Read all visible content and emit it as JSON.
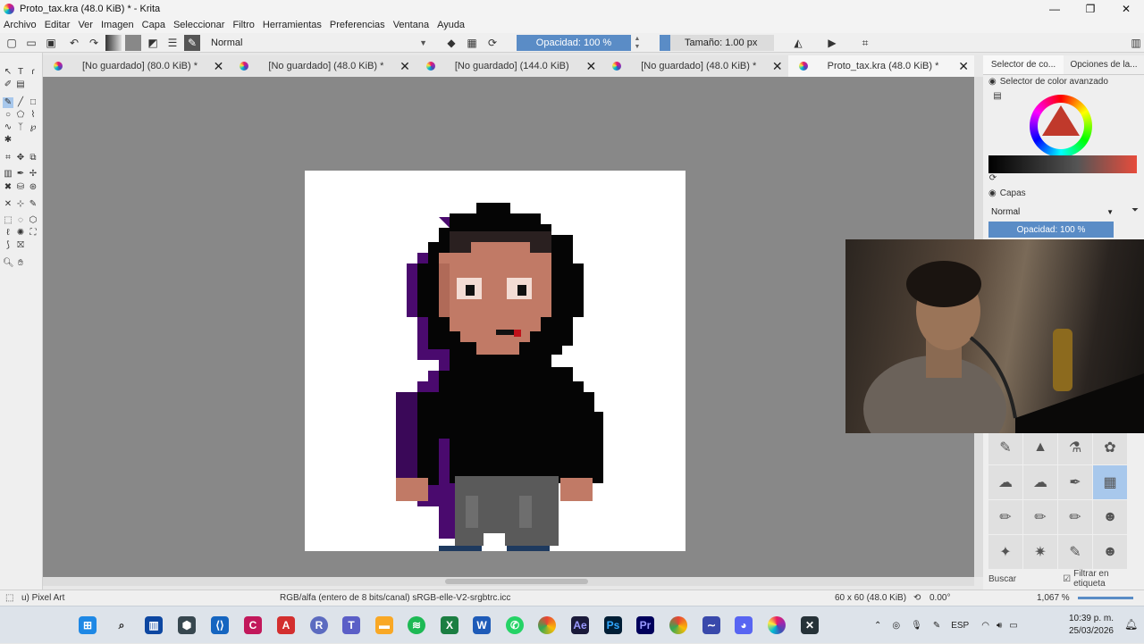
{
  "window": {
    "title": "Proto_tax.kra (48.0 KiB) * - Krita",
    "controls": [
      "—",
      "❐",
      "✕"
    ]
  },
  "menu": [
    "Archivo",
    "Editar",
    "Ver",
    "Imagen",
    "Capa",
    "Seleccionar",
    "Filtro",
    "Herramientas",
    "Preferencias",
    "Ventana",
    "Ayuda"
  ],
  "toolbar": {
    "blend_mode": "Normal",
    "opacity_label": "Opacidad: 100 %",
    "opacity_value": 100,
    "size_label": "Tamaño: 1.00 px"
  },
  "tabs": [
    {
      "label": "[No guardado]  (80.0 KiB) *",
      "active": false
    },
    {
      "label": "[No guardado]  (48.0 KiB) *",
      "active": false
    },
    {
      "label": "[No guardado]  (144.0 KiB)",
      "active": false
    },
    {
      "label": "[No guardado]  (48.0 KiB) *",
      "active": false
    },
    {
      "label": "Proto_tax.kra (48.0 KiB) *",
      "active": true
    }
  ],
  "dock": {
    "tab1": "Selector de co...",
    "tab2": "Opciones de la...",
    "color_panel_title": "Selector de color avanzado",
    "layers_panel_title": "Capas",
    "layer_blend": "Normal",
    "layer_opacity": "Opacidad: 100 %",
    "search_label": "Buscar",
    "filter_label": "Filtrar en etiqueta"
  },
  "status": {
    "brush": "u) Pixel Art",
    "color_space": "RGB/alfa (entero de 8 bits/canal)  sRGB-elle-V2-srgbtrc.icc",
    "image_size": "60 x 60 (48.0 KiB)",
    "rotation": "0.00°",
    "zoom": "1,067 %"
  },
  "taskbar": {
    "language": "ESP",
    "time": "10:39 p. m.",
    "date": "25/03/2026"
  },
  "colors": {
    "accent": "#5a8cc6",
    "canvas_bg": "#888888",
    "hood": "#050505",
    "hood_shade": "#4a0a6e",
    "skin": "#c17a66",
    "pants": "#5a5a5a"
  }
}
